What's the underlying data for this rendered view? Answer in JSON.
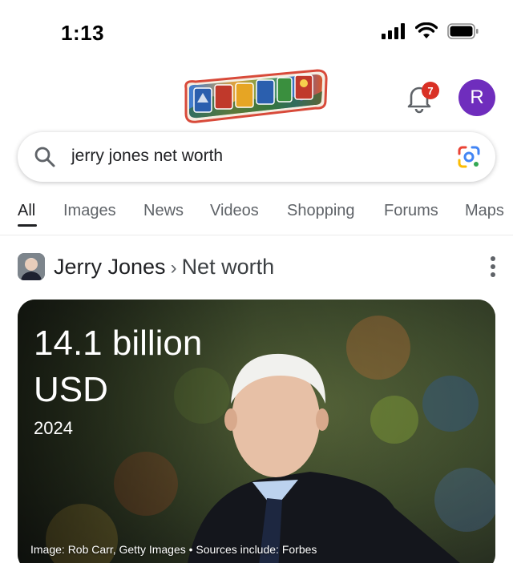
{
  "status_bar": {
    "time": "1:13",
    "icons": [
      "cellular-signal-icon",
      "wifi-icon",
      "battery-icon"
    ]
  },
  "header": {
    "doodle_text": "Google",
    "notification_count": "7",
    "avatar_initial": "R"
  },
  "search": {
    "query": "jerry jones net worth",
    "icons": [
      "search-icon",
      "google-lens-icon"
    ]
  },
  "tabs": [
    {
      "label": "All",
      "active": true
    },
    {
      "label": "Images",
      "active": false
    },
    {
      "label": "News",
      "active": false
    },
    {
      "label": "Videos",
      "active": false
    },
    {
      "label": "Shopping",
      "active": false
    },
    {
      "label": "Forums",
      "active": false
    },
    {
      "label": "Maps",
      "active": false
    }
  ],
  "result": {
    "entity": "Jerry Jones",
    "separator": "›",
    "attribute": "Net worth",
    "value_line1": "14.1 billion",
    "value_line2": "USD",
    "year": "2024",
    "credit": "Image: Rob Carr, Getty Images • Sources include: Forbes"
  },
  "colors": {
    "accent_avatar": "#6f2dbd",
    "badge_red": "#d93025",
    "text_primary": "#202124",
    "text_secondary": "#5f6368"
  }
}
